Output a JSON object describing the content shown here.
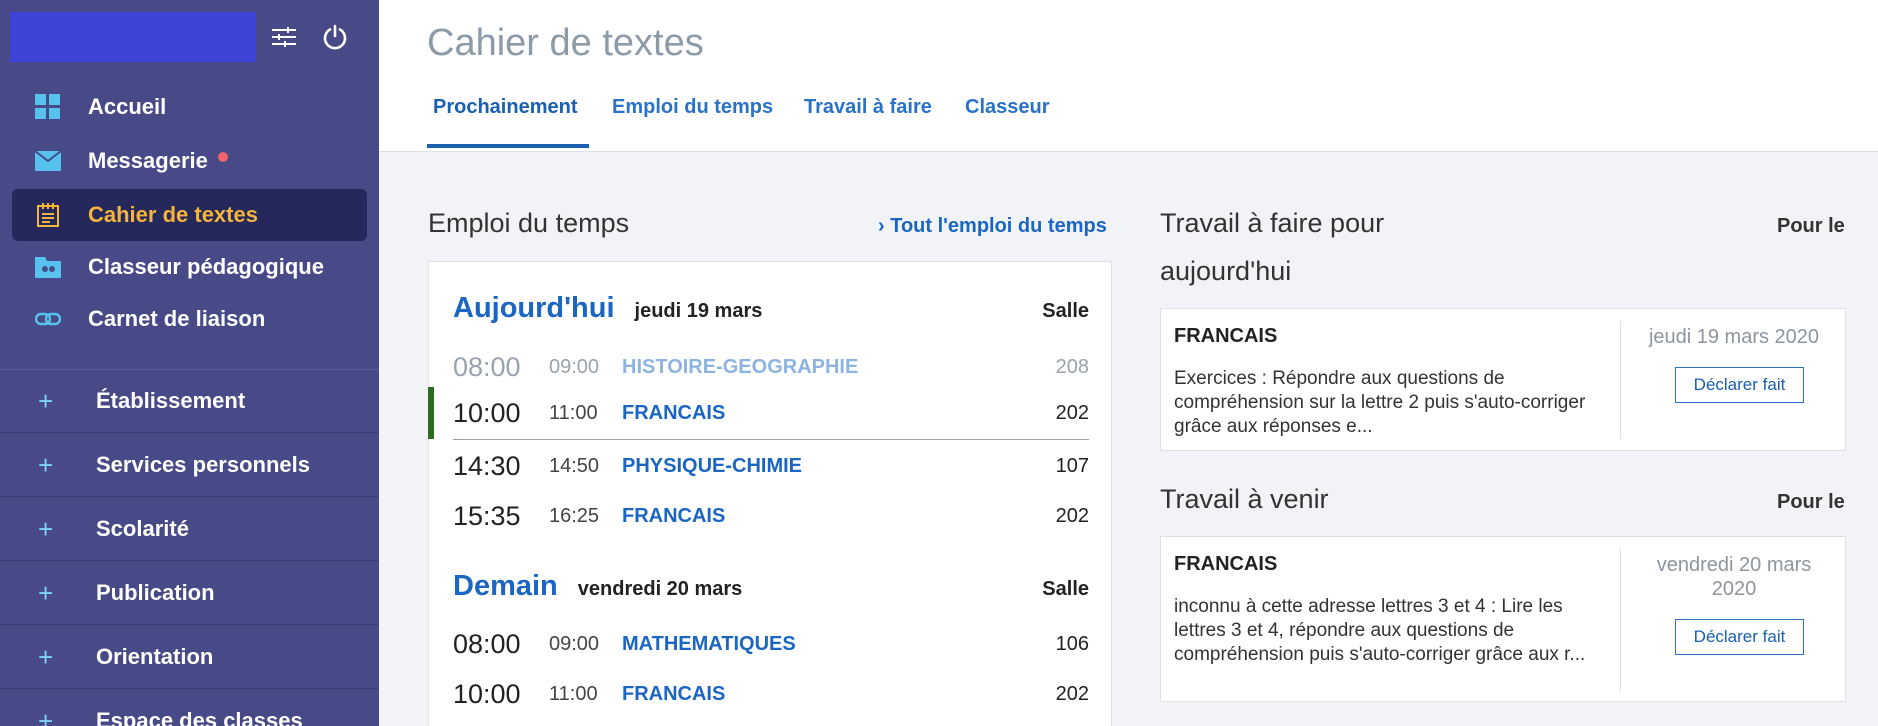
{
  "sidebar": {
    "nav": [
      {
        "label": "Accueil"
      },
      {
        "label": "Messagerie"
      },
      {
        "label": "Cahier de textes"
      },
      {
        "label": "Classeur pédagogique"
      },
      {
        "label": "Carnet de liaison"
      }
    ],
    "sections": [
      {
        "label": "Établissement"
      },
      {
        "label": "Services personnels"
      },
      {
        "label": "Scolarité"
      },
      {
        "label": "Publication"
      },
      {
        "label": "Orientation"
      },
      {
        "label": "Espace des classes"
      }
    ],
    "colors": {
      "bg": "#474a86",
      "active_bg": "#25285a",
      "active_text": "#f6b43a",
      "notification_dot": "#f2636d"
    }
  },
  "header": {
    "title": "Cahier de textes",
    "tabs": [
      {
        "label": "Prochainement"
      },
      {
        "label": "Emploi du temps"
      },
      {
        "label": "Travail à faire"
      },
      {
        "label": "Classeur"
      }
    ]
  },
  "timetable": {
    "heading": "Emploi du temps",
    "link": "› Tout l'emploi du temps",
    "days": [
      {
        "name": "Aujourd'hui",
        "date": "jeudi 19 mars",
        "room_header": "Salle",
        "rows": [
          {
            "start": "08:00",
            "end": "09:00",
            "subject": "HISTOIRE-GEOGRAPHIE",
            "room": "208"
          },
          {
            "start": "10:00",
            "end": "11:00",
            "subject": "FRANCAIS",
            "room": "202"
          },
          {
            "start": "14:30",
            "end": "14:50",
            "subject": "PHYSIQUE-CHIMIE",
            "room": "107"
          },
          {
            "start": "15:35",
            "end": "16:25",
            "subject": "FRANCAIS",
            "room": "202"
          }
        ]
      },
      {
        "name": "Demain",
        "date": "vendredi 20 mars",
        "room_header": "Salle",
        "rows": [
          {
            "start": "08:00",
            "end": "09:00",
            "subject": "MATHEMATIQUES",
            "room": "106"
          },
          {
            "start": "10:00",
            "end": "11:00",
            "subject": "FRANCAIS",
            "room": "202"
          }
        ]
      }
    ]
  },
  "homework_today": {
    "heading_line1": "Travail à faire pour",
    "heading_line2": "aujourd'hui",
    "pour_le": "Pour le",
    "items": [
      {
        "subject": "FRANCAIS",
        "text": "Exercices : Répondre aux questions de compréhension sur la lettre 2 puis s'auto-corriger grâce aux réponses e...",
        "date": "jeudi 19 mars 2020",
        "button": "Déclarer fait"
      }
    ]
  },
  "homework_upcoming": {
    "heading": "Travail à venir",
    "pour_le": "Pour le",
    "items": [
      {
        "subject": "FRANCAIS",
        "text": "inconnu à cette adresse lettres 3 et 4 : Lire les lettres 3 et 4, répondre aux questions de compréhension puis s'auto-corriger grâce aux r...",
        "date": "vendredi 20 mars 2020",
        "button": "Déclarer fait"
      }
    ]
  }
}
